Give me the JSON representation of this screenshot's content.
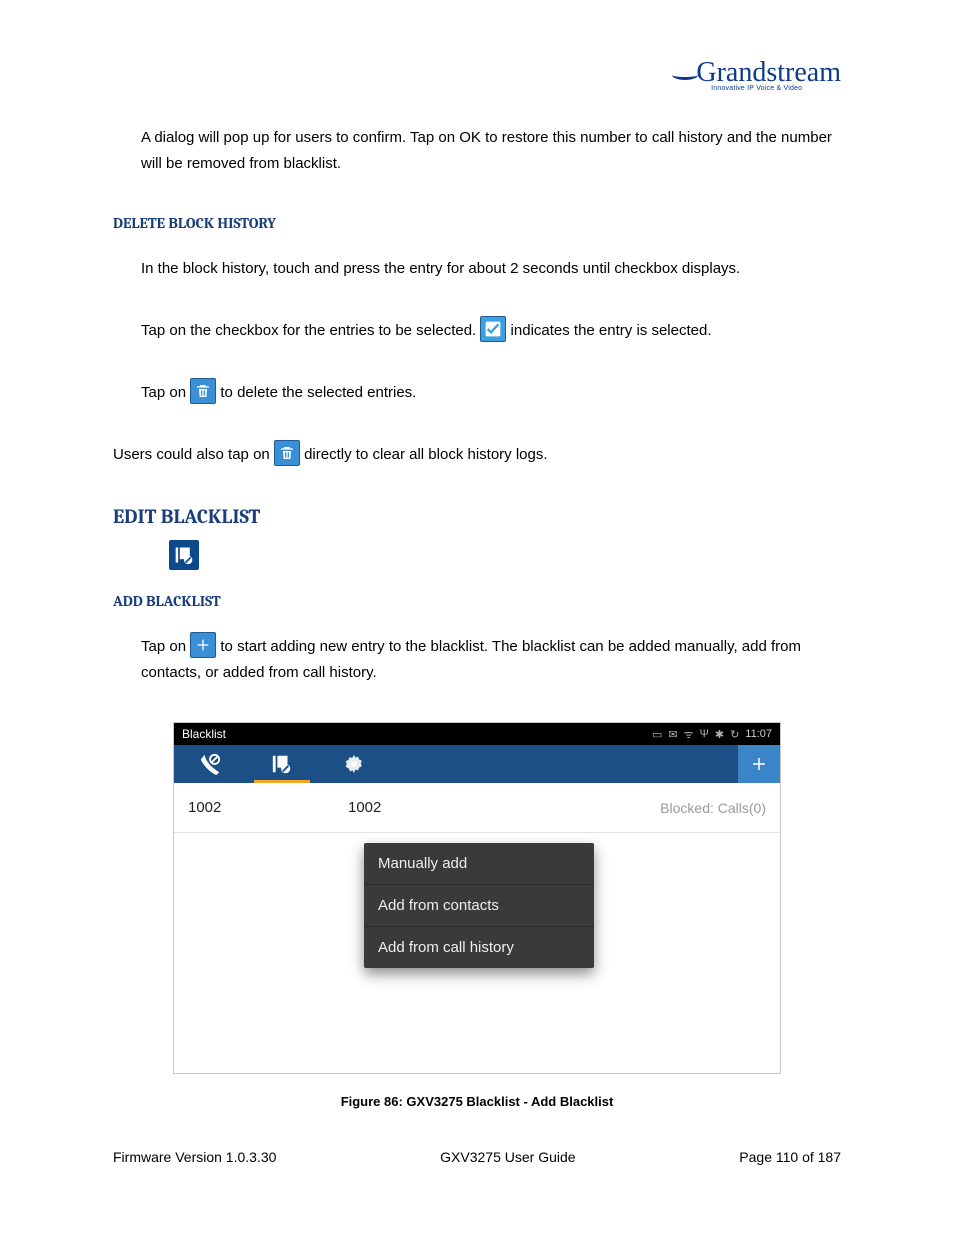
{
  "logo": {
    "brand": "Grandstream",
    "tagline": "Innovative IP Voice & Video"
  },
  "intro_para": "A dialog will pop up for users to confirm. Tap on OK to restore this number to call history and the number will be removed from blacklist.",
  "delete_block_history": {
    "heading": "DELETE BLOCK HISTORY",
    "line1": "In the block history, touch and press the entry for about 2 seconds until checkbox displays.",
    "line2a": "Tap on the checkbox for the entries to be selected. ",
    "line2b": " indicates the entry is selected.",
    "line3a": "Tap on ",
    "line3b": " to delete the selected entries.",
    "line4a": "Users could also tap on ",
    "line4b": " directly to clear all block history logs."
  },
  "edit_blacklist_heading": "EDIT BLACKLIST",
  "add_blacklist": {
    "heading": "ADD BLACKLIST",
    "line1a": "Tap on ",
    "line1b": " to start adding new entry to the blacklist. The blacklist can be added manually, add from contacts, or added from call history."
  },
  "screenshot": {
    "title": "Blacklist",
    "status_icons": [
      "HD",
      "vm",
      "wifi",
      "usb",
      "bt",
      "sync"
    ],
    "time": "11:07",
    "row": {
      "name": "1002",
      "number": "1002",
      "stat": "Blocked: Calls(0)"
    },
    "menu": [
      "Manually add",
      "Add from contacts",
      "Add from call history"
    ]
  },
  "caption": "Figure 86: GXV3275 Blacklist - Add Blacklist",
  "footer": {
    "left": "Firmware Version 1.0.3.30",
    "center": "GXV3275 User Guide",
    "right": "Page 110 of 187"
  }
}
